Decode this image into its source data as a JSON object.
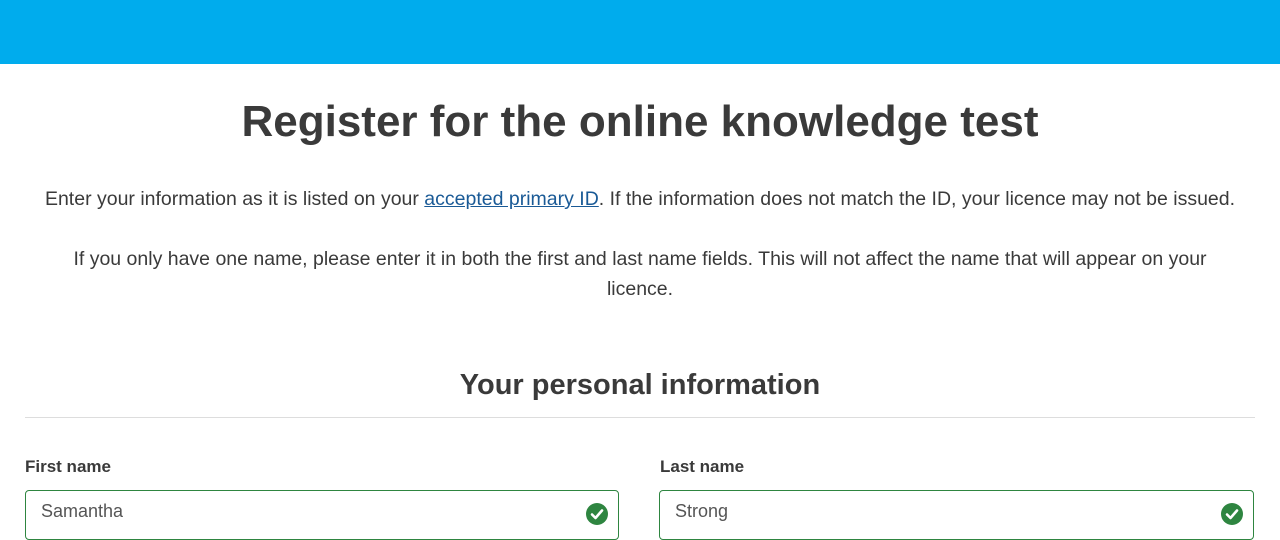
{
  "header": {
    "color": "#00aced"
  },
  "page": {
    "title": "Register for the online knowledge test",
    "intro_before": "Enter your information as it is listed on your ",
    "intro_link": "accepted primary ID",
    "intro_after": ". If the information does not match the ID, your licence may not be issued.",
    "note": "If you only have one name, please enter it in both the first and last name fields. This will not affect the name that will appear on your licence."
  },
  "section": {
    "title": "Your personal information"
  },
  "form": {
    "first_name": {
      "label": "First name",
      "value": "Samantha",
      "status_icon": "check-circle-icon"
    },
    "last_name": {
      "label": "Last name",
      "value": "Strong",
      "status_icon": "check-circle-icon"
    },
    "valid_color": "#2e8540",
    "link_color": "#1a5a96"
  }
}
